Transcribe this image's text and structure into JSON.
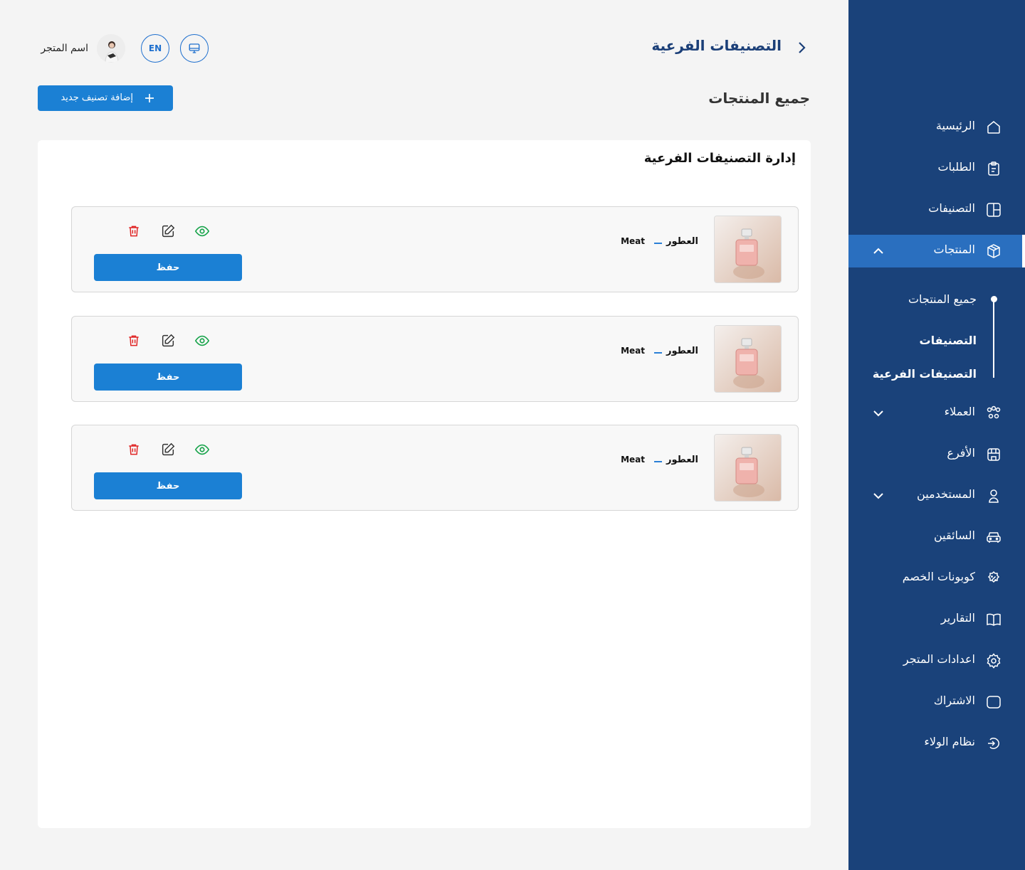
{
  "header": {
    "title": "التصنيفات الفرعية",
    "language_button": "EN",
    "store_name": "اسم المتجر"
  },
  "main": {
    "section_heading": "جميع المنتجات",
    "add_button_label": "إضافة تصنيف جديد",
    "panel_title": "إدارة التصنيفات الفرعية",
    "rows": [
      {
        "category": "العطور",
        "subcategory": "Meat",
        "save_label": "حفظ"
      },
      {
        "category": "العطور",
        "subcategory": "Meat",
        "save_label": "حفظ"
      },
      {
        "category": "العطور",
        "subcategory": "Meat",
        "save_label": "حفظ"
      }
    ]
  },
  "sidebar": {
    "items": [
      {
        "label": "الرئيسية",
        "icon": "home-icon"
      },
      {
        "label": "الطلبات",
        "icon": "orders-icon"
      },
      {
        "label": "التصنيفات",
        "icon": "categories-icon"
      },
      {
        "label": "المنتجات",
        "icon": "box-icon",
        "active": true
      },
      {
        "label": "العملاء",
        "icon": "customers-icon"
      },
      {
        "label": "الأفرع",
        "icon": "store-icon"
      },
      {
        "label": "المستخدمين",
        "icon": "user-icon"
      },
      {
        "label": "السائقين",
        "icon": "car-icon"
      },
      {
        "label": "كوبونات الخصم",
        "icon": "discount-icon"
      },
      {
        "label": "التقارير",
        "icon": "book-icon"
      },
      {
        "label": "اعدادات المتجر",
        "icon": "settings-icon"
      },
      {
        "label": "الاشتراك",
        "icon": "subscription-icon"
      },
      {
        "label": "نظام الولاء",
        "icon": "loyalty-icon"
      }
    ],
    "sub_items": [
      {
        "label": "جميع المنتجات"
      },
      {
        "label": "التصنيفات"
      },
      {
        "label": "التصنيفات الفرعية"
      }
    ]
  },
  "colors": {
    "sidebar_bg": "#1a427a",
    "active_bg": "#2a6fbf",
    "primary": "#1b80d4",
    "view_icon": "#17a34a",
    "delete_icon": "#e02424"
  }
}
